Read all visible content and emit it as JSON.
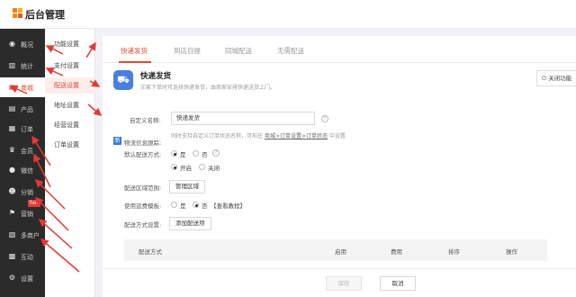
{
  "app": {
    "title": "后台管理"
  },
  "sidebar": {
    "items": [
      {
        "label": "概况",
        "icon": "dashboard-icon"
      },
      {
        "label": "统计",
        "icon": "chart-icon"
      },
      {
        "label": "商城",
        "icon": "shop-icon",
        "active": true
      },
      {
        "label": "产品",
        "icon": "product-icon"
      },
      {
        "label": "订单",
        "icon": "order-icon"
      },
      {
        "label": "会员",
        "icon": "crown-icon"
      },
      {
        "label": "微信",
        "icon": "wechat-icon"
      },
      {
        "label": "分销",
        "icon": "distribution-icon"
      },
      {
        "label": "营销",
        "icon": "flag-icon"
      },
      {
        "label": "多商户",
        "icon": "merchant-icon"
      },
      {
        "label": "互动",
        "icon": "interact-icon"
      },
      {
        "label": "设置",
        "icon": "gear-icon"
      }
    ],
    "hot_badge": "hot"
  },
  "subnav": {
    "items": [
      {
        "label": "功能设置"
      },
      {
        "label": "支付设置"
      },
      {
        "label": "配送设置",
        "active": true
      },
      {
        "label": "地址设置"
      },
      {
        "label": "经营设置"
      },
      {
        "label": "订单设置"
      }
    ]
  },
  "tabs": [
    {
      "label": "快递发货",
      "active": true
    },
    {
      "label": "到店自提"
    },
    {
      "label": "同城配送"
    },
    {
      "label": "无需配送"
    }
  ],
  "method": {
    "title": "快递发货",
    "description": "买家下单时可选择快递发货，由商家安排快递送货上门。",
    "close_button": "关闭功能"
  },
  "form": {
    "custom_name": {
      "label": "自定义名称:",
      "value": "快递发货"
    },
    "custom_name_hint_prefix": "同时支持自定义订单状态名称，可前往",
    "custom_name_hint_link": "商城>订单设置>订单状态",
    "custom_name_hint_suffix": "中设置",
    "default_method": {
      "label": "默认配送方式:",
      "options": [
        "是",
        "否"
      ]
    },
    "tracking": {
      "label": "物流信息跟踪:",
      "badge": "新",
      "options": [
        "开启",
        "关闭"
      ]
    },
    "delivery_area": {
      "label": "配送区域范围:",
      "button": "管理区域"
    },
    "freight_template": {
      "label": "使用运费模板:",
      "options": [
        "是",
        "否"
      ],
      "link": "【查看教程】"
    },
    "delivery_methods": {
      "label": "配送方式设置:",
      "button": "添加配送项"
    }
  },
  "table": {
    "headers": [
      "配送方式",
      "启用",
      "费用",
      "排序",
      "操作"
    ]
  },
  "footer": {
    "save": "保存",
    "cancel": "取消"
  },
  "colors": {
    "accent": "#e04b2c",
    "sidebar_bg": "#2b2b2b",
    "arrow": "#e53935"
  }
}
